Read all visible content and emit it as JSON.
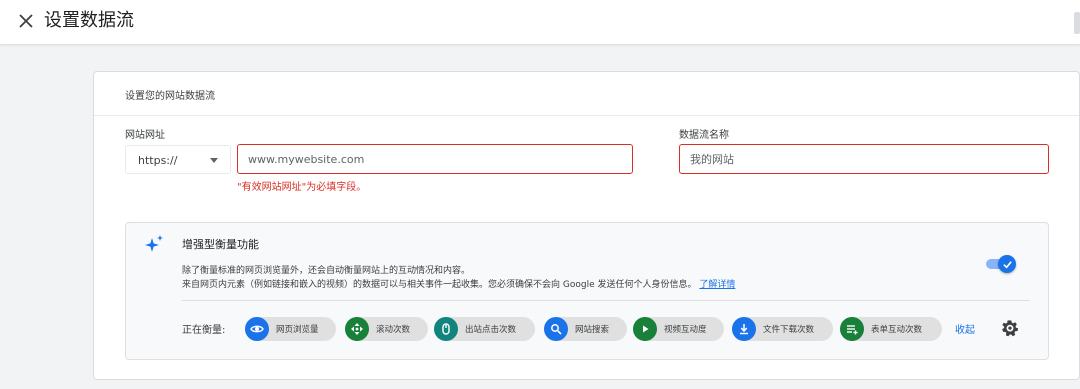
{
  "header": {
    "title": "设置数据流"
  },
  "card": {
    "title": "设置您的网站数据流",
    "url_label": "网站网址",
    "protocol": "https://",
    "url_placeholder": "www.mywebsite.com",
    "url_error": "\"有效网站网址\"为必填字段。",
    "name_label": "数据流名称",
    "name_placeholder": "我的网站"
  },
  "enhanced": {
    "title": "增强型衡量功能",
    "desc1": "除了衡量标准的网页浏览量外，还会自动衡量网站上的互动情况和内容。",
    "desc2": "来自网页内元素（例如链接和嵌入的视频）的数据可以与相关事件一起收集。您必须确保不会向 Google 发送任何个人身份信息。",
    "learn_more": "了解详情",
    "toggle_on": true,
    "measuring_label": "正在衡量:",
    "chips": [
      {
        "label": "网页浏览量",
        "icon": "eye-icon",
        "color": "#1a73e8"
      },
      {
        "label": "滚动次数",
        "icon": "scroll-icon",
        "color": "#188038"
      },
      {
        "label": "出站点击次数",
        "icon": "mouse-icon",
        "color": "#12847e"
      },
      {
        "label": "网站搜索",
        "icon": "search-icon",
        "color": "#1a73e8"
      },
      {
        "label": "视频互动度",
        "icon": "play-icon",
        "color": "#188038"
      },
      {
        "label": "文件下载次数",
        "icon": "download-icon",
        "color": "#1a73e8"
      },
      {
        "label": "表单互动次数",
        "icon": "form-icon",
        "color": "#188038"
      }
    ],
    "collapse_label": "收起"
  }
}
